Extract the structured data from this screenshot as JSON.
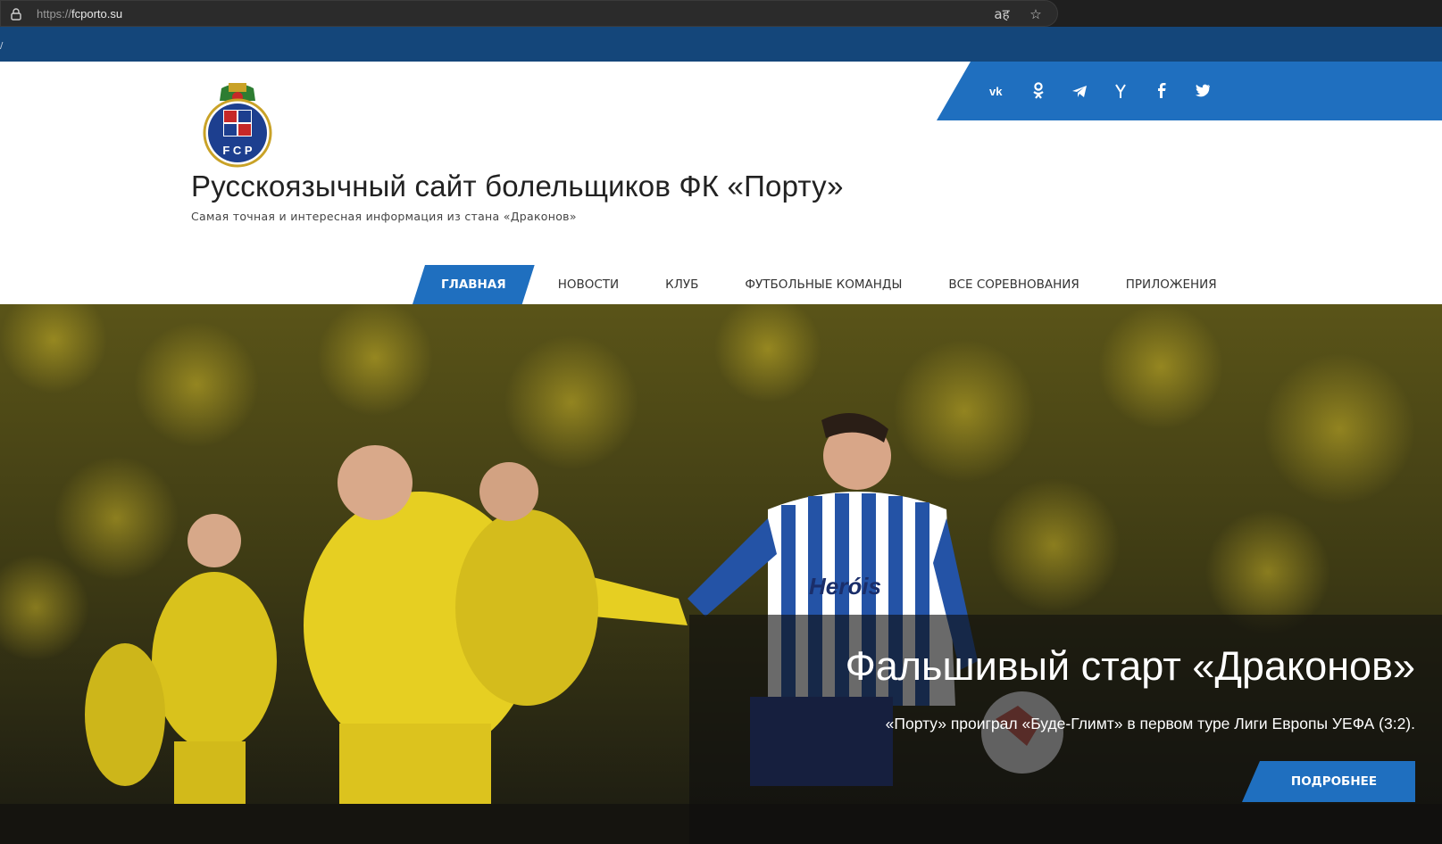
{
  "browser": {
    "url_protocol": "https://",
    "url_host": "fcporto.su",
    "translate_icon": "translate-icon",
    "bookmark_icon": "star-icon"
  },
  "topstrip": {
    "edge_char": "/"
  },
  "social": {
    "items": [
      {
        "name": "vk",
        "glyph": "vk"
      },
      {
        "name": "odnoklassniki",
        "glyph": "ok"
      },
      {
        "name": "telegram",
        "glyph": "tg"
      },
      {
        "name": "yandex",
        "glyph": "Y"
      },
      {
        "name": "facebook",
        "glyph": "f"
      },
      {
        "name": "twitter",
        "glyph": "tw"
      }
    ]
  },
  "site": {
    "title": "Русскоязычный сайт болельщиков ФК «Порту»",
    "tagline": "Самая точная и интересная информация из стана «Драконов»",
    "logo_letters": "F C P"
  },
  "nav": {
    "items": [
      {
        "label": "Главная"
      },
      {
        "label": "Новости"
      },
      {
        "label": "Клуб"
      },
      {
        "label": "Футбольные команды"
      },
      {
        "label": "Все соревнования"
      },
      {
        "label": "Приложения"
      }
    ]
  },
  "hero": {
    "title": "Фальшивый старт «Драконов»",
    "subtitle": "«Порту» проиграл «Буде-Глимт» в первом туре Лиги Европы УЕФА (3:2).",
    "button_label": "Подробнее",
    "jersey_sponsor": "Heróis"
  },
  "colors": {
    "brand_blue": "#1f6fbf",
    "dark_blue": "#14467a"
  }
}
